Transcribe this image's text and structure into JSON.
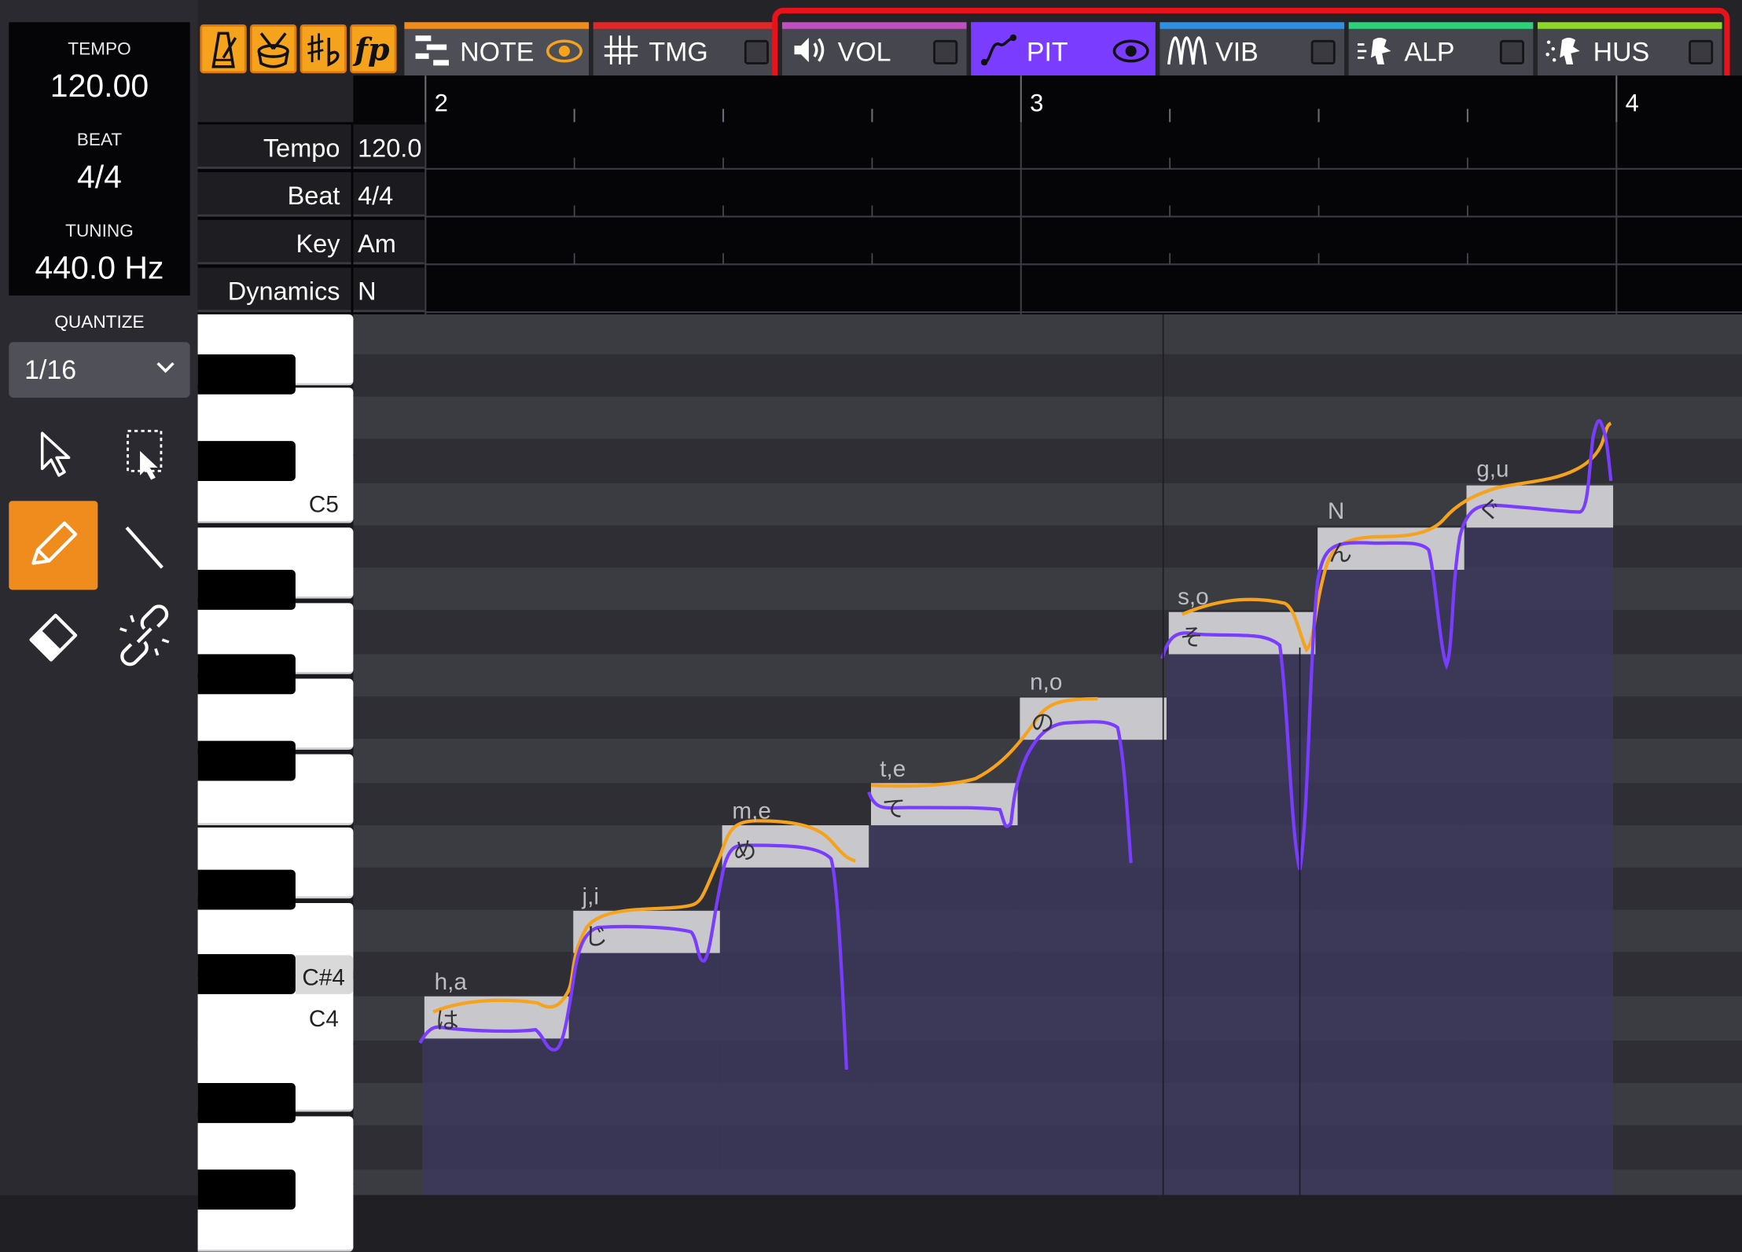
{
  "info": {
    "tempo_label": "TEMPO",
    "tempo_value": "120.00",
    "beat_label": "BEAT",
    "beat_value": "4/4",
    "tuning_label": "TUNING",
    "tuning_value": "440.0 Hz"
  },
  "quantize": {
    "label": "QUANTIZE",
    "value": "1/16"
  },
  "tools": [
    "select-arrow",
    "marquee-select",
    "pencil",
    "line",
    "eraser",
    "unlink"
  ],
  "toolbar": {
    "icon_buttons": [
      "metronome-icon",
      "drum-icon",
      "sharp-flat-icon",
      "dynamics-fp-icon"
    ],
    "tabs": [
      {
        "label": "NOTE",
        "stripe": "#f08c1e"
      },
      {
        "label": "TMG",
        "stripe": "#e02828"
      },
      {
        "label": "VOL",
        "stripe": "#c050c0"
      },
      {
        "label": "PIT",
        "stripe": "#7a3cff"
      },
      {
        "label": "VIB",
        "stripe": "#2f8fe0"
      },
      {
        "label": "ALP",
        "stripe": "#2ed07a"
      },
      {
        "label": "HUS",
        "stripe": "#8ed62a"
      }
    ]
  },
  "ruler": {
    "bars": [
      "2",
      "3",
      "4"
    ]
  },
  "params": [
    {
      "label": "Tempo",
      "value": "120.0"
    },
    {
      "label": "Beat",
      "value": "4/4"
    },
    {
      "label": "Key",
      "value": "Am"
    },
    {
      "label": "Dynamics",
      "value": "N"
    }
  ],
  "keyboard_labels": {
    "c5": "C5",
    "csharp4": "C#4",
    "c4": "C4"
  },
  "notes": [
    {
      "lyric": "h,a",
      "kana": "は"
    },
    {
      "lyric": "j,i",
      "kana": "じ"
    },
    {
      "lyric": "m,e",
      "kana": "め"
    },
    {
      "lyric": "t,e",
      "kana": "て"
    },
    {
      "lyric": "n,o",
      "kana": "の"
    },
    {
      "lyric": "s,o",
      "kana": "そ"
    },
    {
      "lyric": "N",
      "kana": "ん"
    },
    {
      "lyric": "g,u",
      "kana": "ぐ"
    }
  ],
  "colors": {
    "accent": "#f08c1e",
    "pitch_curve": "#7a3cff",
    "orig_pitch_curve": "#f5a21c",
    "highlight": "#e8131a"
  }
}
